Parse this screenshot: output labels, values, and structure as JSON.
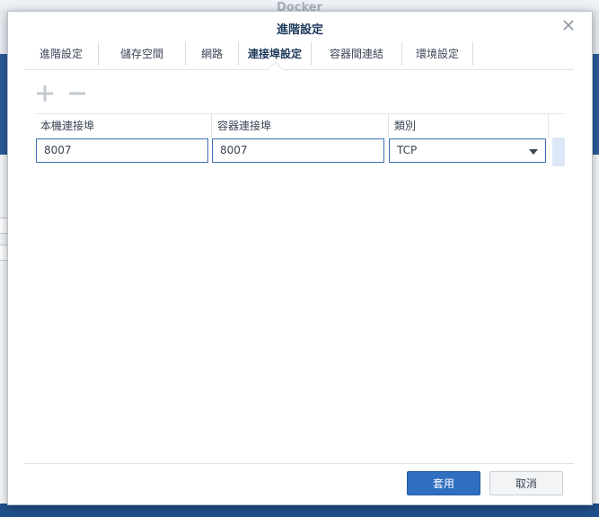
{
  "background": {
    "app_title": "Docker"
  },
  "dialog": {
    "title": "進階設定",
    "tabs": [
      {
        "label": "進階設定",
        "active": false
      },
      {
        "label": "儲存空間",
        "active": false
      },
      {
        "label": "網路",
        "active": false
      },
      {
        "label": "連接埠設定",
        "active": true
      },
      {
        "label": "容器間連結",
        "active": false
      },
      {
        "label": "環境設定",
        "active": false
      }
    ],
    "toolbar": {
      "add_icon": "plus-icon",
      "remove_icon": "minus-icon"
    },
    "grid": {
      "columns": [
        "本機連接埠",
        "容器連接埠",
        "類別"
      ],
      "rows": [
        {
          "local_port": "8007",
          "container_port": "8007",
          "type": "TCP"
        }
      ]
    },
    "buttons": {
      "apply": "套用",
      "cancel": "取消"
    }
  },
  "colors": {
    "primary": "#2f6fc0",
    "header_blue": "#2c5c9a",
    "input_border": "#3d6fb3",
    "row_stripe": "#dce8f7"
  }
}
